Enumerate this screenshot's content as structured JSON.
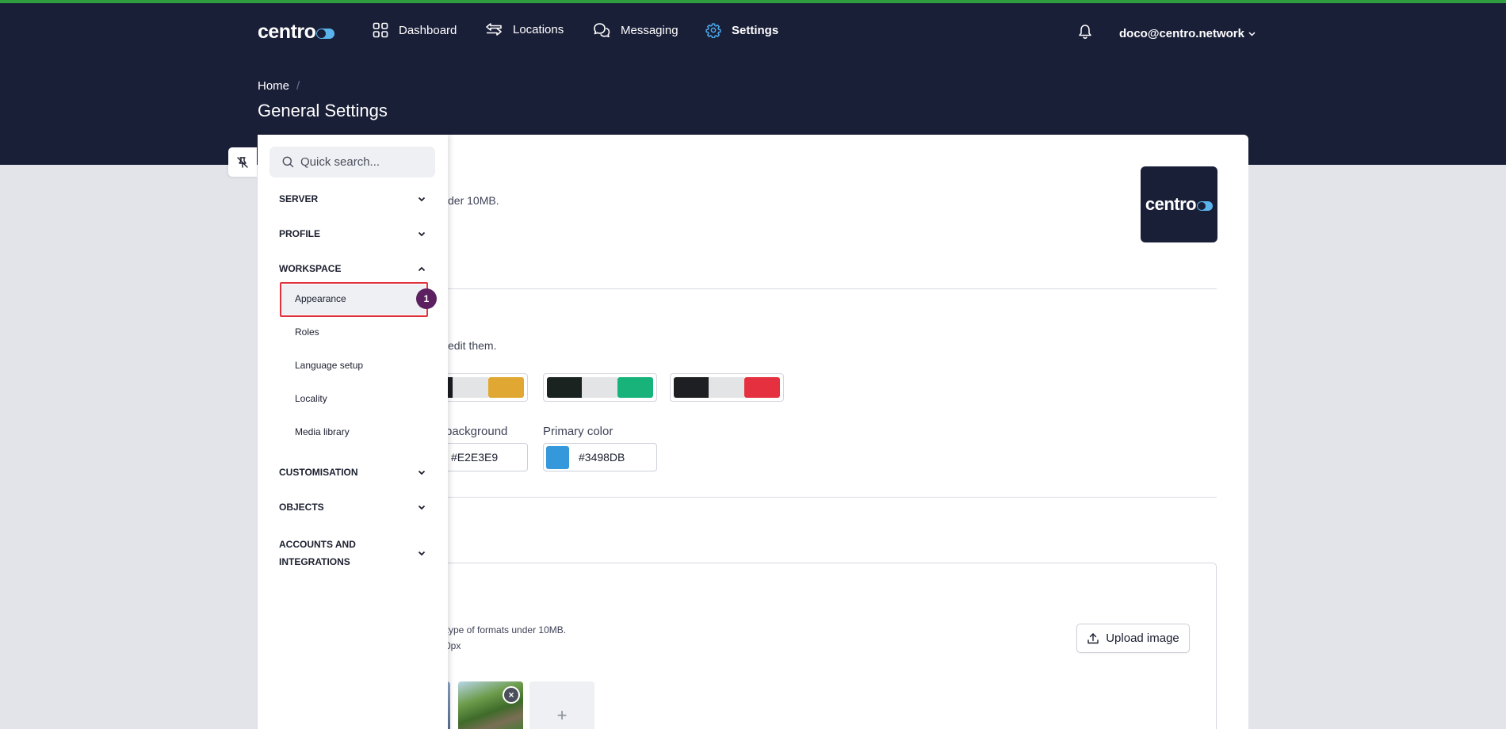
{
  "app": {
    "logo": "centro"
  },
  "nav": {
    "items": [
      {
        "label": "Dashboard",
        "icon": "grid-icon"
      },
      {
        "label": "Locations",
        "icon": "arrows-icon"
      },
      {
        "label": "Messaging",
        "icon": "chat-icon"
      },
      {
        "label": "Settings",
        "icon": "gear-icon",
        "active": true
      }
    ],
    "user": "doco@centro.network"
  },
  "breadcrumb": {
    "home": "Home",
    "separator": "/"
  },
  "page": {
    "title": "General Settings"
  },
  "sidebar": {
    "search_placeholder": "Quick search...",
    "sections": {
      "server": "SERVER",
      "profile": "PROFILE",
      "workspace": "WORKSPACE",
      "customisation": "CUSTOMISATION",
      "objects": "OBJECTS",
      "accounts": "ACCOUNTS AND INTEGRATIONS"
    },
    "workspace_items": [
      "Appearance",
      "Roles",
      "Language setup",
      "Locality",
      "Media library"
    ],
    "active_item": "Appearance",
    "annotation_badge": "1"
  },
  "main": {
    "logo_hint": "der 10MB.",
    "themes_hint": "edit them.",
    "themes": [
      {
        "colors": [
          "#1b1c20",
          "#e3e4e6",
          "#e0a832"
        ]
      },
      {
        "colors": [
          "#1a2320",
          "#e3e4e6",
          "#17b37a"
        ]
      },
      {
        "colors": [
          "#1e1f22",
          "#e3e4e6",
          "#e5313f"
        ]
      }
    ],
    "background_label": "background",
    "background_value": "#E2E3E9",
    "primary_label": "Primary color",
    "primary_value": "#3498DB",
    "primary_chip": "#3498DB",
    "media_hint_1": "G type of formats under 10MB.",
    "media_hint_2": "0px",
    "upload_label": "Upload image",
    "remove_label": "×",
    "add_label": "+"
  },
  "colors": {
    "header_bg": "#1a1f38",
    "accent": "#3498DB",
    "top_line": "#2e9e3f",
    "highlight": "#e0323c",
    "badge": "#5c2060"
  }
}
